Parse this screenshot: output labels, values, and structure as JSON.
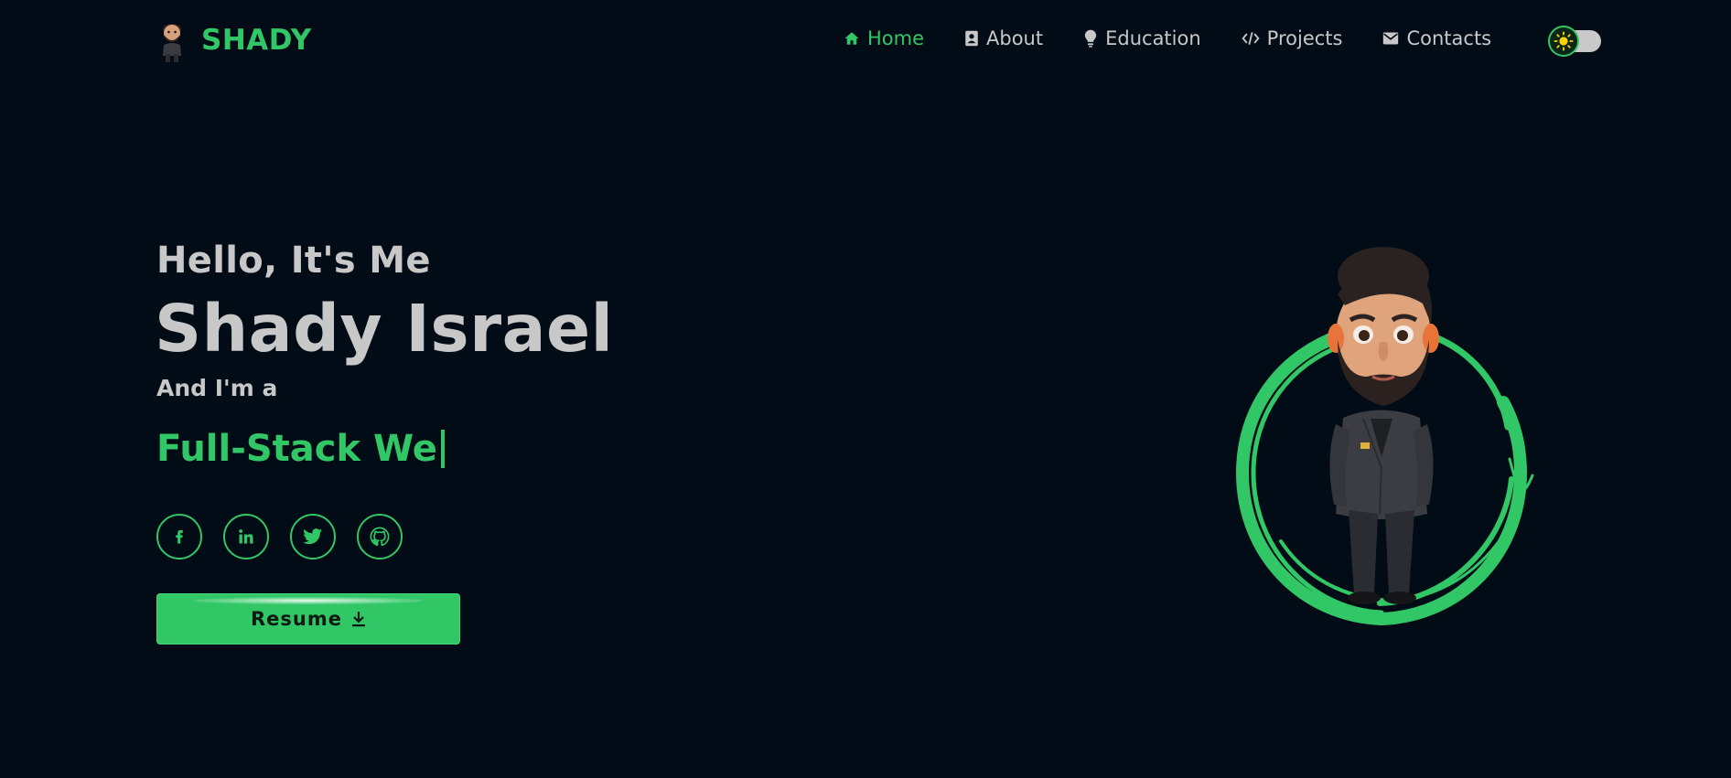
{
  "brand": {
    "name": "SHADY",
    "avatar_icon": "avatar-icon"
  },
  "nav": {
    "items": [
      {
        "label": "Home",
        "icon": "home-icon",
        "active": true
      },
      {
        "label": "About",
        "icon": "id-card-icon",
        "active": false
      },
      {
        "label": "Education",
        "icon": "lightbulb-icon",
        "active": false
      },
      {
        "label": "Projects",
        "icon": "code-icon",
        "active": false
      },
      {
        "label": "Contacts",
        "icon": "envelope-icon",
        "active": false
      }
    ]
  },
  "theme_toggle": {
    "icon": "sun-icon",
    "state": "dark"
  },
  "hero": {
    "greeting": "Hello, It's Me",
    "name": "Shady Israel",
    "role_intro": "And I'm a",
    "role_typed": "Full-Stack We"
  },
  "socials": [
    {
      "icon": "facebook-icon"
    },
    {
      "icon": "linkedin-icon"
    },
    {
      "icon": "twitter-icon"
    },
    {
      "icon": "github-icon"
    }
  ],
  "resume": {
    "label": "Resume",
    "icon": "download-icon"
  },
  "colors": {
    "background": "#010c16",
    "accent": "#31c766",
    "text": "#c8c8c8"
  }
}
